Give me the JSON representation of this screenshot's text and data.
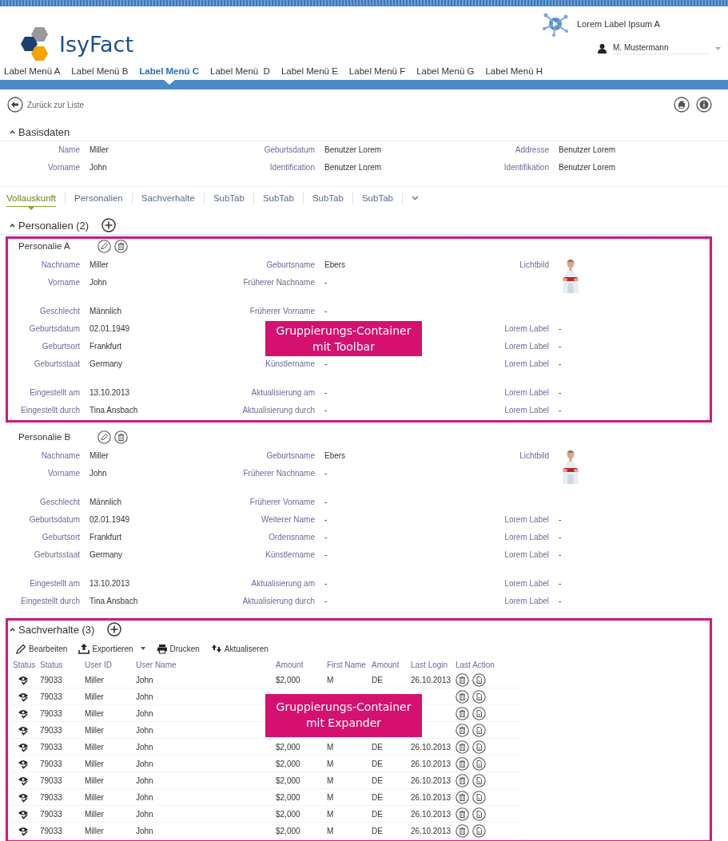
{
  "header": {
    "logo_text": "IsyFact",
    "app_label": "Lorem Label Ipsum A",
    "user": "M. Mustermann"
  },
  "menu": [
    {
      "label": "Label Menü A",
      "selected": false
    },
    {
      "label": "Label Menü B",
      "selected": false
    },
    {
      "label": "Label Menü C",
      "selected": true
    },
    {
      "label": "Label Menü  D",
      "selected": false
    },
    {
      "label": "Label Menü E",
      "selected": false
    },
    {
      "label": "Label Menü F",
      "selected": false
    },
    {
      "label": "Label Menü G",
      "selected": false
    },
    {
      "label": "Label Menü H",
      "selected": false
    }
  ],
  "back_link": "Zurück zur Liste",
  "basisdaten": {
    "title": "Basisdaten",
    "expanded": true,
    "rows": [
      [
        {
          "label": "Name",
          "value": "Miller"
        },
        {
          "label": "Geburtsdatum",
          "value": "Benutzer Lorem"
        },
        {
          "label": "Addresse",
          "value": "Benutzer Lorem"
        }
      ],
      [
        {
          "label": "Vorname",
          "value": "John"
        },
        {
          "label": "Identification",
          "value": "Benutzer Lorem"
        },
        {
          "label": "Identifikation",
          "value": "Benutzer Lorem"
        }
      ]
    ]
  },
  "tabs": [
    {
      "label": "Vollauskunft",
      "selected": true
    },
    {
      "label": "Personalien",
      "selected": false
    },
    {
      "label": "Sachverhalte",
      "selected": false
    },
    {
      "label": "SubTab",
      "selected": false
    },
    {
      "label": "SubTab",
      "selected": false
    },
    {
      "label": "SubTab",
      "selected": false
    },
    {
      "label": "SubTab",
      "selected": false
    }
  ],
  "personalien": {
    "title": "Personalien (2)",
    "expanded": true,
    "items": [
      {
        "title": "Personalie A",
        "highlighted": true,
        "overlay": "Gruppierungs-Container mit Toolbar",
        "groups": [
          [
            {
              "left": {
                "kind": "text",
                "label": "Nachname",
                "value": "Miller"
              },
              "middle": {
                "kind": "text",
                "label": "Geburtsname",
                "value": "Ebers"
              },
              "right": {
                "label": "Lichtbild"
              }
            },
            {
              "left": {
                "kind": "text",
                "label": "Vorname",
                "value": "John"
              },
              "middle": {
                "kind": "text",
                "label": "Früherer Nachname",
                "value": "-"
              }
            }
          ],
          [
            {
              "left": {
                "kind": "text",
                "label": "Geschlecht",
                "value": "Männlich"
              },
              "middle": {
                "kind": "text",
                "label": "Früherer Vorname",
                "value": "-"
              }
            },
            {
              "left": {
                "kind": "text",
                "label": "Geburtsdatum",
                "value": "02.01.1949"
              },
              "right": {
                "kind": "text",
                "label": "Lorem Label",
                "value": "-"
              }
            },
            {
              "left": {
                "kind": "text",
                "label": "Geburtsort",
                "value": "Frankfurt"
              },
              "right": {
                "kind": "text",
                "label": "Lorem Label",
                "value": "-"
              }
            },
            {
              "left": {
                "kind": "text",
                "label": "Geburtsstaat",
                "value": "Germany"
              },
              "middle": {
                "kind": "text",
                "label": "Künstlername",
                "value": "-"
              },
              "right": {
                "kind": "text",
                "label": "Lorem Label",
                "value": "-"
              }
            }
          ],
          [
            {
              "left": {
                "kind": "text",
                "label": "Eingestellt am",
                "value": "13.10.2013"
              },
              "middle": {
                "kind": "text",
                "label": "Aktualisierung am",
                "value": "-"
              },
              "right": {
                "kind": "text",
                "label": "Lorem Label",
                "value": "-"
              }
            },
            {
              "left": {
                "kind": "text",
                "label": "Eingestellt durch",
                "value": "Tina Ansbach"
              },
              "middle": {
                "kind": "text",
                "label": "Aktualisierung durch",
                "value": "-"
              },
              "right": {
                "kind": "text",
                "label": "Lorem Label",
                "value": "-"
              }
            }
          ]
        ]
      },
      {
        "title": "Personalie B",
        "highlighted": false,
        "groups": [
          [
            {
              "left": {
                "kind": "text",
                "label": "Nachname",
                "value": "Miller"
              },
              "middle": {
                "kind": "text",
                "label": "Geburtsname",
                "value": "Ebers"
              },
              "right": {
                "label": "Lichtbild"
              }
            },
            {
              "left": {
                "kind": "text",
                "label": "Vorname",
                "value": "John"
              },
              "middle": {
                "kind": "text",
                "label": "Früherer Nachname",
                "value": "-"
              }
            }
          ],
          [
            {
              "left": {
                "kind": "text",
                "label": "Geschlecht",
                "value": "Männlich"
              },
              "middle": {
                "kind": "text",
                "label": "Früherer Vorname",
                "value": "-"
              }
            },
            {
              "left": {
                "kind": "text",
                "label": "Geburtsdatum",
                "value": "02.01.1949"
              },
              "middle": {
                "kind": "text",
                "label": "Weiterer Name",
                "value": "-"
              },
              "right": {
                "kind": "text",
                "label": "Lorem Label",
                "value": "-"
              }
            },
            {
              "left": {
                "kind": "text",
                "label": "Geburtsort",
                "value": "Frankfurt"
              },
              "middle": {
                "kind": "text",
                "label": "Ordensname",
                "value": "-"
              },
              "right": {
                "kind": "text",
                "label": "Lorem Label",
                "value": "-"
              }
            },
            {
              "left": {
                "kind": "text",
                "label": "Geburtsstaat",
                "value": "Germany"
              },
              "middle": {
                "kind": "text",
                "label": "Künstlername",
                "value": "-"
              },
              "right": {
                "kind": "text",
                "label": "Lorem Label",
                "value": "-"
              }
            }
          ],
          [
            {
              "left": {
                "kind": "text",
                "label": "Eingestellt am",
                "value": "13.10.2013"
              },
              "middle": {
                "kind": "text",
                "label": "Aktualisierung am",
                "value": "-"
              },
              "right": {
                "kind": "text",
                "label": "Lorem Label",
                "value": "-"
              }
            },
            {
              "left": {
                "kind": "text",
                "label": "Eingestellt durch",
                "value": "Tina Ansbach"
              },
              "middle": {
                "kind": "text",
                "label": "Aktualisierung durch",
                "value": "-"
              },
              "right": {
                "kind": "text",
                "label": "Lorem Label",
                "value": "-"
              }
            }
          ]
        ]
      }
    ]
  },
  "sachverhalte": {
    "title": "Sachverhalte (3)",
    "expanded": true,
    "highlighted": true,
    "overlay": "Gruppierungs-Container mit Expander",
    "toolbar": [
      {
        "kind": "edit",
        "label": "Bearbeiten"
      },
      {
        "kind": "export",
        "label": "Exportieren"
      },
      {
        "kind": "print",
        "label": "Drucken"
      },
      {
        "kind": "refresh",
        "label": "Aktualiseren"
      }
    ],
    "columns": [
      "Status",
      "Status",
      "User ID",
      "User Name",
      "Amount",
      "First Name",
      "Amount",
      "Last Login",
      "Last Action"
    ],
    "rows": [
      [
        "",
        "79033",
        "Miller",
        "John",
        "$2,000",
        "M",
        "DE",
        "26.10.2013"
      ],
      [
        "",
        "79033",
        "Miller",
        "John",
        null,
        null,
        null,
        null
      ],
      [
        "",
        "79033",
        "Miller",
        "John",
        null,
        null,
        null,
        null
      ],
      [
        "",
        "79033",
        "Miller",
        "John",
        null,
        null,
        null,
        null
      ],
      [
        "",
        "79033",
        "Miller",
        "John",
        "$2,000",
        "M",
        "DE",
        "26.10.2013"
      ],
      [
        "",
        "79033",
        "Miller",
        "John",
        "$2,000",
        "M",
        "DE",
        "26.10.2013"
      ],
      [
        "",
        "79033",
        "Miller",
        "John",
        "$2,000",
        "M",
        "DE",
        "26.10.2013"
      ],
      [
        "",
        "79033",
        "Miller",
        "John",
        "$2,000",
        "M",
        "DE",
        "26.10.2013"
      ],
      [
        "",
        "79033",
        "Miller",
        "John",
        "$2,000",
        "M",
        "DE",
        "26.10.2013"
      ],
      [
        "",
        "79033",
        "Miller",
        "John",
        "$2,000",
        "M",
        "DE",
        "26.10.2013"
      ]
    ]
  }
}
